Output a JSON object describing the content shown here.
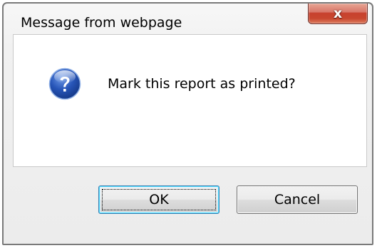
{
  "dialog": {
    "title": "Message from webpage",
    "close_symbol": "x",
    "close_icon": "close-icon",
    "message_icon": "question-icon",
    "message": "Mark this report as printed?",
    "buttons": {
      "ok_label": "OK",
      "cancel_label": "Cancel"
    },
    "colors": {
      "close_button": "#c7412e",
      "question_icon": "#1f4fa8",
      "focus_border": "#3c7fb1"
    }
  }
}
